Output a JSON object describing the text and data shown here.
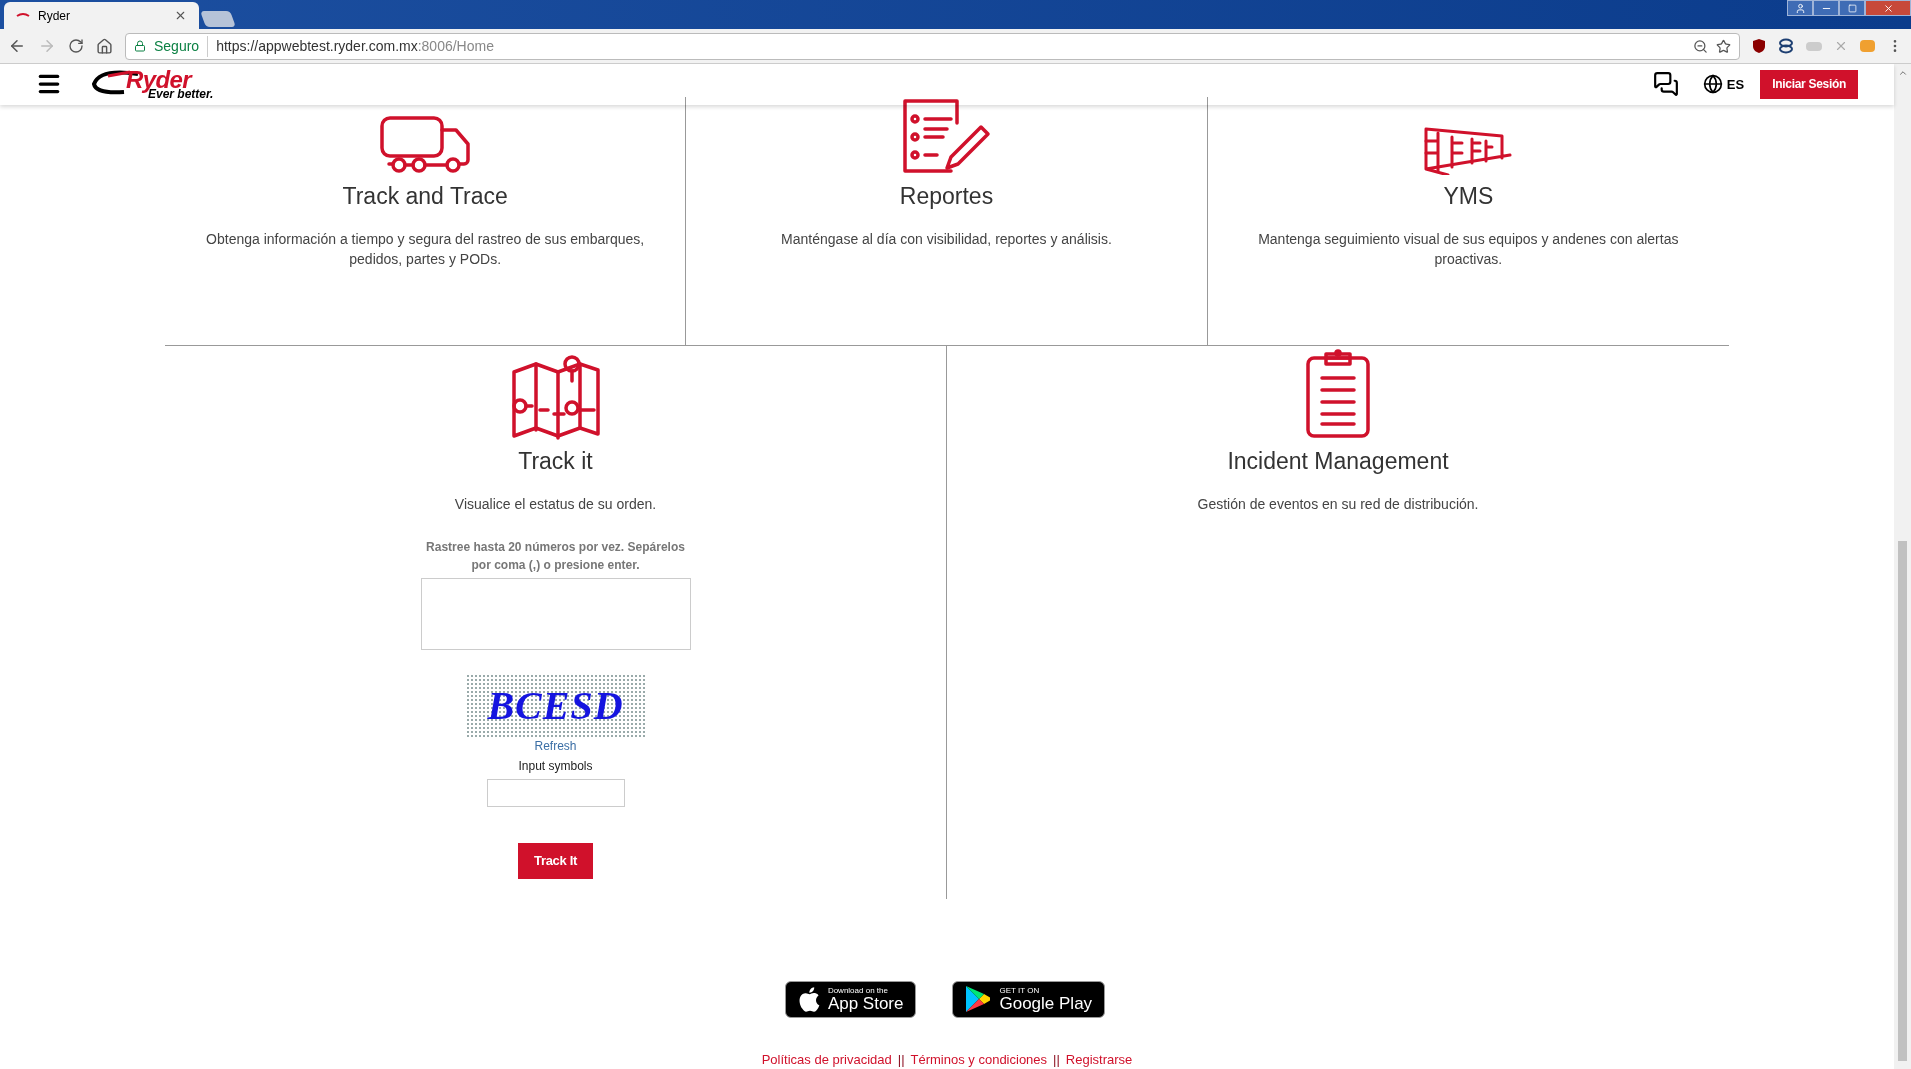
{
  "browser": {
    "tab_title": "Ryder",
    "secure_label": "Seguro",
    "url_host": "https://appwebtest.ryder.com.mx",
    "url_rest": ":8006/Home"
  },
  "header": {
    "logo_name": "Ryder",
    "logo_tagline": "Ever better.",
    "language": "ES",
    "login_button": "Iniciar Sesión"
  },
  "modules_top": [
    {
      "kind": "truck",
      "title": "Track and Trace",
      "description": "Obtenga información a tiempo y segura del rastreo de sus embarques, pedidos, partes y PODs."
    },
    {
      "kind": "report",
      "title": "Reportes",
      "description": "Manténgase al día con visibilidad, reportes y análisis."
    },
    {
      "kind": "yard",
      "title": "YMS",
      "description": "Mantenga seguimiento visual de sus equipos y andenes con alertas proactivas."
    }
  ],
  "modules_bottom": [
    {
      "kind": "map",
      "title": "Track it",
      "description": "Visualice el estatus de su orden."
    },
    {
      "kind": "clipboard",
      "title": "Incident Management",
      "description": "Gestión de eventos en su red de distribución."
    }
  ],
  "tracking_form": {
    "instructions": "Rastree hasta 20 números por vez. Sepárelos por coma (,) o presione enter.",
    "captcha_text": "BCESD",
    "refresh_link": "Refresh",
    "captcha_label": "Input symbols",
    "button": "Track It"
  },
  "app_badges": [
    {
      "kind": "apple",
      "line1": "Download on the",
      "line2": "App Store"
    },
    {
      "kind": "google",
      "line1": "GET IT ON",
      "line2": "Google Play"
    }
  ],
  "footer_links": [
    {
      "kind": "link",
      "text": "Políticas de privacidad"
    },
    {
      "kind": "separator",
      "text": "||"
    },
    {
      "kind": "link",
      "text": "Términos y condiciones"
    },
    {
      "kind": "separator",
      "text": "||"
    },
    {
      "kind": "link",
      "text": "Registrarse"
    }
  ]
}
